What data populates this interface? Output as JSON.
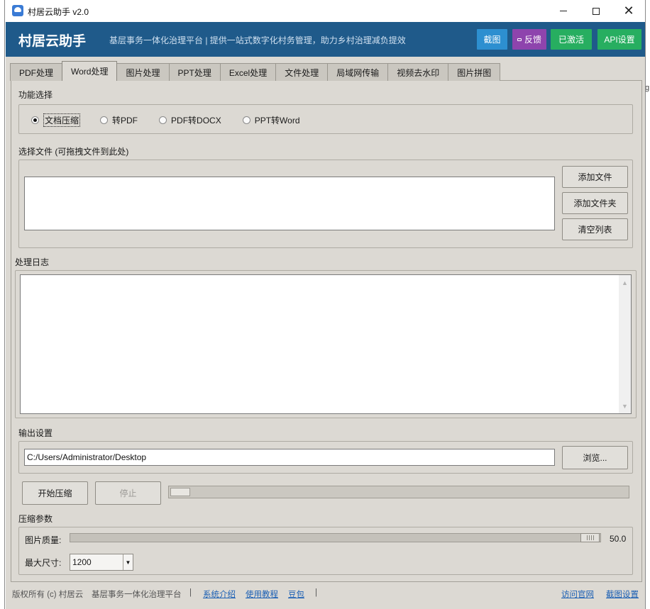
{
  "window": {
    "title": "村居云助手 v2.0"
  },
  "header": {
    "title": "村居云助手",
    "subtitle": "基层事务一体化治理平台 | 提供一站式数字化村务管理，助力乡村治理减负提效",
    "buttons": {
      "screenshot": "截图",
      "feedback": "反馈",
      "activated": "已激活",
      "api_settings": "API设置"
    },
    "colors": {
      "background": "#1f5a8a",
      "screenshot": "#2d8fd0",
      "feedback": "#8e44ad",
      "activated": "#27ae60",
      "api": "#27ae60"
    }
  },
  "tabs": [
    {
      "label": "PDF处理",
      "active": false
    },
    {
      "label": "Word处理",
      "active": true
    },
    {
      "label": "图片处理",
      "active": false
    },
    {
      "label": "PPT处理",
      "active": false
    },
    {
      "label": "Excel处理",
      "active": false
    },
    {
      "label": "文件处理",
      "active": false
    },
    {
      "label": "局域网传输",
      "active": false
    },
    {
      "label": "视频去水印",
      "active": false
    },
    {
      "label": "图片拼图",
      "active": false
    }
  ],
  "function_select": {
    "label": "功能选择",
    "options": [
      "文档压缩",
      "转PDF",
      "PDF转DOCX",
      "PPT转Word"
    ],
    "selected": "文档压缩"
  },
  "file_select": {
    "label": "选择文件 (可拖拽文件到此处)",
    "add_file": "添加文件",
    "add_folder": "添加文件夹",
    "clear_list": "清空列表"
  },
  "log": {
    "label": "处理日志"
  },
  "output": {
    "label": "输出设置",
    "path": "C:/Users/Administrator/Desktop",
    "browse": "浏览..."
  },
  "actions": {
    "start": "开始压缩",
    "stop": "停止",
    "progress": 0
  },
  "compression": {
    "label": "压缩参数",
    "quality_label": "图片质量:",
    "quality_value": "50.0",
    "max_size_label": "最大尺寸:",
    "max_size_value": "1200"
  },
  "footer": {
    "copyright": "版权所有 (c) 村居云",
    "platform": "基层事务一体化治理平台",
    "sep": "|",
    "links": {
      "intro": "系统介绍",
      "tutorial": "使用教程",
      "doubao": "豆包",
      "official": "访问官网",
      "screenshot_settings": "截图设置"
    }
  }
}
